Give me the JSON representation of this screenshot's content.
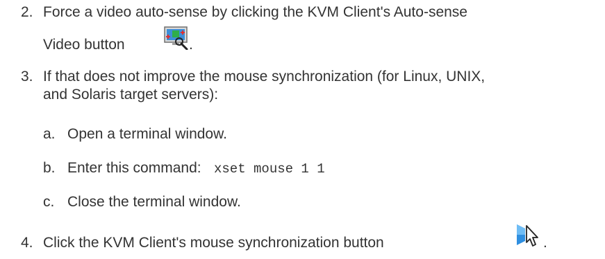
{
  "steps": [
    {
      "number": "2.",
      "line1": "Force a video auto-sense by clicking the KVM Client's Auto-sense",
      "line2": "Video button",
      "line2_suffix": ".",
      "icon": "auto-sense-video-icon"
    },
    {
      "number": "3.",
      "line1": "If that does not improve the mouse synchronization (for Linux, UNIX,",
      "line2": "and Solaris target servers):",
      "substeps": [
        {
          "letter": "a.",
          "text": "Open a terminal window."
        },
        {
          "letter": "b.",
          "text": "Enter this command: ",
          "code": "xset mouse 1 1"
        },
        {
          "letter": "c.",
          "text": "Close the terminal window."
        }
      ]
    },
    {
      "number": "4.",
      "line1": "Click the KVM Client's mouse synchronization button",
      "line1_suffix": ".",
      "icon": "mouse-sync-icon"
    }
  ]
}
